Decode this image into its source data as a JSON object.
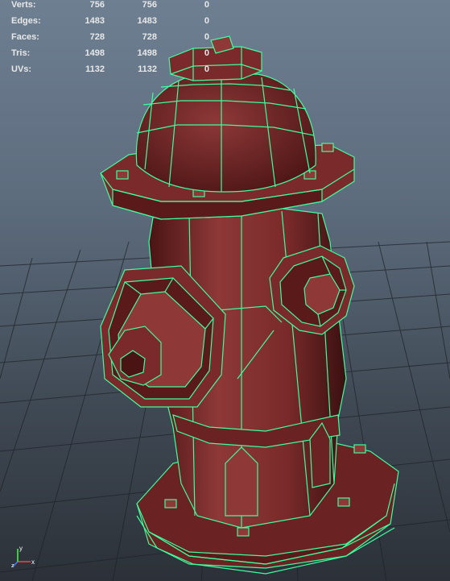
{
  "hud": {
    "rows": [
      {
        "label": "Verts:",
        "total": "756",
        "selected": "756",
        "highlighted": "0"
      },
      {
        "label": "Edges:",
        "total": "1483",
        "selected": "1483",
        "highlighted": "0"
      },
      {
        "label": "Faces:",
        "total": "728",
        "selected": "728",
        "highlighted": "0"
      },
      {
        "label": "Tris:",
        "total": "1498",
        "selected": "1498",
        "highlighted": "0"
      },
      {
        "label": "UVs:",
        "total": "1132",
        "selected": "1132",
        "highlighted": "0"
      }
    ]
  },
  "colors": {
    "wire": "#3dff9e",
    "body": "#7a2a2a",
    "body_dark": "#4a1414",
    "body_light": "#8e3838",
    "grid_line": "#1f2328",
    "background_top": "#6e7f92"
  },
  "axis_indicator": {
    "x": "x",
    "y": "y",
    "z": "z"
  }
}
